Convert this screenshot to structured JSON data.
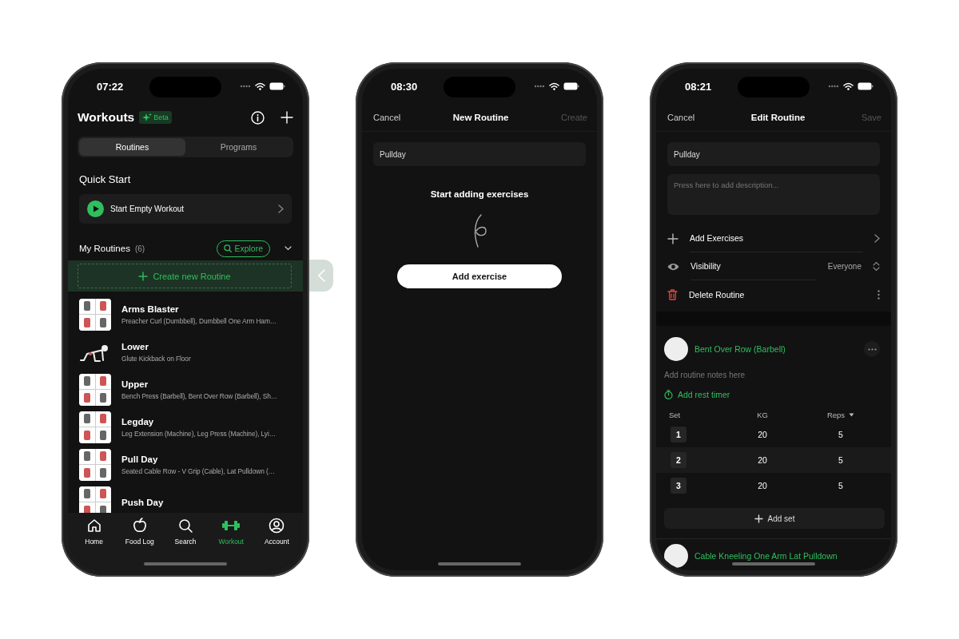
{
  "phones": [
    {
      "kind": "workouts",
      "status": {
        "time": "07:22"
      },
      "header": {
        "title": "Workouts",
        "badge": "Beta"
      },
      "segments": [
        {
          "label": "Routines",
          "selected": true
        },
        {
          "label": "Programs",
          "selected": false
        }
      ],
      "quick_start": {
        "heading": "Quick Start",
        "action": "Start Empty Workout"
      },
      "routines_section": {
        "heading": "My Routines",
        "count": "(6)",
        "explore": "Explore",
        "create": "Create new Routine"
      },
      "routines": [
        {
          "title": "Arms Blaster",
          "exercises": "Preacher Curl (Dumbbell), Dumbbell One Arm Ham…",
          "kind": "grid"
        },
        {
          "title": "Lower",
          "exercises": "Glute Kickback on Floor",
          "kind": "figure"
        },
        {
          "title": "Upper",
          "exercises": "Bench Press (Barbell), Bent Over Row (Barbell), Sh…",
          "kind": "grid"
        },
        {
          "title": "Legday",
          "exercises": "Leg Extension (Machine), Leg Press (Machine), Lyi…",
          "kind": "grid"
        },
        {
          "title": "Pull Day",
          "exercises": "Seated Cable Row - V Grip (Cable), Lat Pulldown (…",
          "kind": "grid"
        },
        {
          "title": "Push Day",
          "kind": "grid"
        }
      ],
      "tab_bar": [
        {
          "label": "Home",
          "selected": false
        },
        {
          "label": "Food Log",
          "selected": false
        },
        {
          "label": "Search",
          "selected": false
        },
        {
          "label": "Workout",
          "selected": true
        },
        {
          "label": "Account",
          "selected": false
        }
      ]
    },
    {
      "kind": "new_routine",
      "status": {
        "time": "08:30"
      },
      "nav": {
        "cancel": "Cancel",
        "title": "New Routine",
        "action": "Create",
        "action_disabled": true
      },
      "name_field": {
        "value": "Pullday"
      },
      "empty_title": "Start adding exercises",
      "button": "Add exercise"
    },
    {
      "kind": "edit_routine",
      "status": {
        "time": "08:21"
      },
      "nav": {
        "cancel": "Cancel",
        "title": "Edit Routine",
        "action": "Save",
        "action_disabled": true
      },
      "name_field": {
        "value": "Pullday"
      },
      "description": {
        "placeholder": "Press here to add description..."
      },
      "options": [
        {
          "kind": "add",
          "label": "Add Exercises"
        },
        {
          "kind": "visibility",
          "label": "Visibility",
          "value": "Everyone"
        },
        {
          "kind": "delete",
          "label": "Delete Routine"
        }
      ],
      "exercise": {
        "name": "Bent Over Row (Barbell)",
        "notes_placeholder": "Add routine notes here",
        "rest_timer": "Add rest timer",
        "columns": [
          "Set",
          "KG",
          "Reps"
        ],
        "sets": [
          {
            "set": "1",
            "kg": "20",
            "reps": "5"
          },
          {
            "set": "2",
            "kg": "20",
            "reps": "5"
          },
          {
            "set": "3",
            "kg": "20",
            "reps": "5"
          }
        ],
        "add_set": "Add set"
      },
      "next_exercise": "Cable Kneeling One Arm Lat Pulldown"
    }
  ]
}
